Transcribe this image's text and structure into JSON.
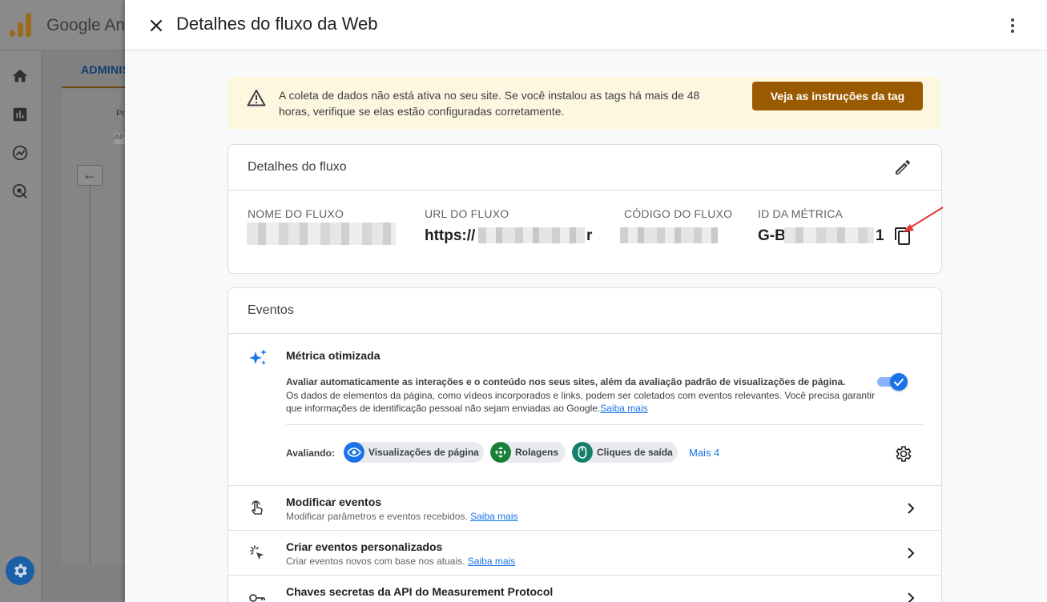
{
  "background": {
    "brand": "Google An",
    "admin_tab": "ADMINIS",
    "pr_text": "Pr",
    "ar_text": "AP"
  },
  "sheet": {
    "title": "Detalhes do fluxo da Web"
  },
  "banner": {
    "message": "A coleta de dados não está ativa no seu site. Se você instalou as tags há mais de 48 horas, verifique se elas estão configuradas corretamente.",
    "button": "Veja as instruções da tag"
  },
  "stream_details": {
    "title": "Detalhes do fluxo",
    "name_label": "NOME DO FLUXO",
    "url_label": "URL DO FLUXO",
    "url_value_start": "https://",
    "url_value_end": "r",
    "code_label": "CÓDIGO DO FLUXO",
    "metric_id_label": "ID DA MÉTRICA",
    "metric_id_start": "G-B",
    "metric_id_end": "1"
  },
  "events": {
    "title": "Eventos",
    "enhanced": {
      "title": "Métrica otimizada",
      "desc_bold": "Avaliar automaticamente as interações e o conteúdo nos seus sites, além da avaliação padrão de visualizações de página.",
      "desc": "Os dados de elementos da página, como vídeos incorporados e links, podem ser coletados com eventos relevantes. Você precisa garantir que informações de identificação pessoal não sejam enviadas ao Google.",
      "learn_more": "Saiba mais",
      "toggle_on": true
    },
    "evaluating_label": "Avaliando:",
    "chips": [
      {
        "label": "Visualizações de página",
        "icon": "eye-icon",
        "color": "#1a73e8"
      },
      {
        "label": "Rolagens",
        "icon": "move-icon",
        "color": "#188038"
      },
      {
        "label": "Cliques de saída",
        "icon": "mouse-icon",
        "color": "#12806a"
      }
    ],
    "more": "Mais 4",
    "rows": [
      {
        "title": "Modificar eventos",
        "subtitle": "Modificar parâmetros e eventos recebidos.",
        "link": "Saiba mais",
        "icon": "touch-icon"
      },
      {
        "title": "Criar eventos personalizados",
        "subtitle": "Criar eventos novos com base nos atuais.",
        "link": "Saiba mais",
        "icon": "sparkle-click-icon"
      },
      {
        "title": "Chaves secretas da API do Measurement Protocol",
        "subtitle": "",
        "link": "",
        "icon": "key-icon"
      }
    ]
  },
  "colors": {
    "accent": "#1a73e8",
    "banner_bg": "#fef7e0",
    "banner_button": "#9a5b00"
  }
}
